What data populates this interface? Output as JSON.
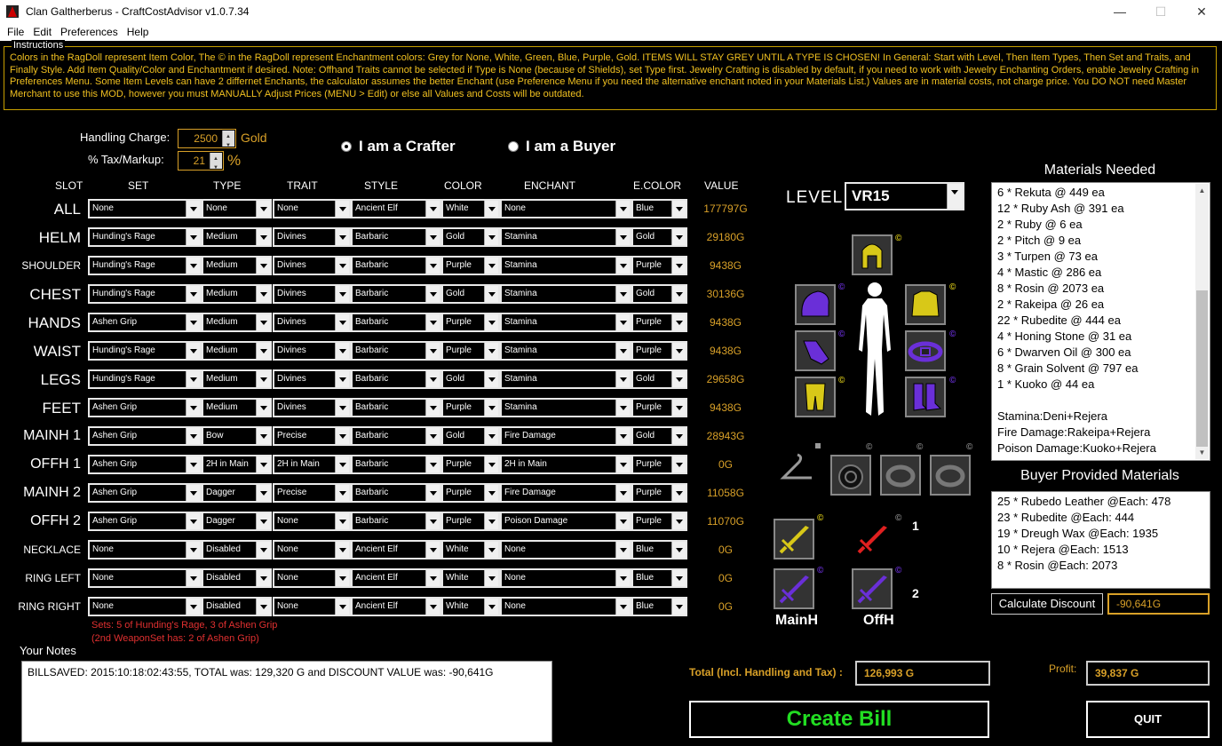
{
  "window": {
    "title": "Clan Galtherberus - CraftCostAdvisor v1.0.7.34",
    "minimize": "—",
    "maximize": "☐",
    "close": "✕"
  },
  "menu": [
    "File",
    "Edit",
    "Preferences",
    "Help"
  ],
  "instructions": {
    "legend": "Instructions",
    "text": "Colors in the RagDoll represent Item Color, The © in the RagDoll represent Enchantment colors:  Grey for None, White, Green, Blue, Purple, Gold.  ITEMS WILL STAY GREY UNTIL A TYPE IS CHOSEN!  In General:  Start with Level, Then Item Types, Then Set and Traits, and Finally Style.  Add Item Quality/Color and Enchantment if desired. Note: Offhand Traits cannot be selected if Type is None (because of Shields), set Type first.  Jewelry Crafting is disabled by default, if you need to work with Jewelry Enchanting Orders, enable Jewelry Crafting in Preferences Menu.  Some Item Levels can have 2 differnet Enchants, the calculator assumes the better Enchant (use Preference Menu if you need the alternative enchant noted in your Materials List.) Values are in material costs, not charge price.  You DO NOT need Master Merchant to use this MOD, however you must MANUALLY Adjust Prices (MENU > Edit) or else all Values and Costs will be outdated."
  },
  "charges": {
    "handling_label": "Handling Charge:",
    "handling_value": "2500",
    "handling_unit": "Gold",
    "tax_label": "% Tax/Markup:",
    "tax_value": "21",
    "tax_unit": "%"
  },
  "mode": {
    "crafter": "I am a Crafter",
    "buyer": "I am a Buyer",
    "selected": "crafter"
  },
  "columns": [
    "SLOT",
    "SET",
    "TYPE",
    "TRAIT",
    "STYLE",
    "COLOR",
    "ENCHANT",
    "E.COLOR",
    "VALUE"
  ],
  "rows": [
    {
      "slot": "ALL",
      "set": "None",
      "type": "None",
      "trait": "None",
      "style": "Ancient Elf",
      "color": "White",
      "enchant": "None",
      "ecolor": "Blue",
      "value": "177797G"
    },
    {
      "slot": "HELM",
      "set": "Hunding's Rage",
      "type": "Medium",
      "trait": "Divines",
      "style": "Barbaric",
      "color": "Gold",
      "enchant": "Stamina",
      "ecolor": "Gold",
      "value": "29180G"
    },
    {
      "slot": "SHOULDER",
      "set": "Hunding's Rage",
      "type": "Medium",
      "trait": "Divines",
      "style": "Barbaric",
      "color": "Purple",
      "enchant": "Stamina",
      "ecolor": "Purple",
      "value": "9438G"
    },
    {
      "slot": "CHEST",
      "set": "Hunding's Rage",
      "type": "Medium",
      "trait": "Divines",
      "style": "Barbaric",
      "color": "Gold",
      "enchant": "Stamina",
      "ecolor": "Gold",
      "value": "30136G"
    },
    {
      "slot": "HANDS",
      "set": "Ashen Grip",
      "type": "Medium",
      "trait": "Divines",
      "style": "Barbaric",
      "color": "Purple",
      "enchant": "Stamina",
      "ecolor": "Purple",
      "value": "9438G"
    },
    {
      "slot": "WAIST",
      "set": "Hunding's Rage",
      "type": "Medium",
      "trait": "Divines",
      "style": "Barbaric",
      "color": "Purple",
      "enchant": "Stamina",
      "ecolor": "Purple",
      "value": "9438G"
    },
    {
      "slot": "LEGS",
      "set": "Hunding's Rage",
      "type": "Medium",
      "trait": "Divines",
      "style": "Barbaric",
      "color": "Gold",
      "enchant": "Stamina",
      "ecolor": "Gold",
      "value": "29658G"
    },
    {
      "slot": "FEET",
      "set": "Ashen Grip",
      "type": "Medium",
      "trait": "Divines",
      "style": "Barbaric",
      "color": "Purple",
      "enchant": "Stamina",
      "ecolor": "Purple",
      "value": "9438G"
    },
    {
      "slot": "MAINH 1",
      "set": "Ashen Grip",
      "type": "Bow",
      "trait": "Precise",
      "style": "Barbaric",
      "color": "Gold",
      "enchant": "Fire Damage",
      "ecolor": "Gold",
      "value": "28943G"
    },
    {
      "slot": "OFFH 1",
      "set": "Ashen Grip",
      "type": "2H in Main",
      "trait": "2H in Main",
      "style": "Barbaric",
      "color": "Purple",
      "enchant": "2H in Main",
      "ecolor": "Purple",
      "value": "0G"
    },
    {
      "slot": "MAINH 2",
      "set": "Ashen Grip",
      "type": "Dagger",
      "trait": "Precise",
      "style": "Barbaric",
      "color": "Purple",
      "enchant": "Fire Damage",
      "ecolor": "Purple",
      "value": "11058G"
    },
    {
      "slot": "OFFH 2",
      "set": "Ashen Grip",
      "type": "Dagger",
      "trait": "None",
      "style": "Barbaric",
      "color": "Purple",
      "enchant": "Poison Damage",
      "ecolor": "Purple",
      "value": "11070G"
    },
    {
      "slot": "NECKLACE",
      "set": "None",
      "type": "Disabled",
      "trait": "None",
      "style": "Ancient Elf",
      "color": "White",
      "enchant": "None",
      "ecolor": "Blue",
      "value": "0G"
    },
    {
      "slot": "RING LEFT",
      "set": "None",
      "type": "Disabled",
      "trait": "None",
      "style": "Ancient Elf",
      "color": "White",
      "enchant": "None",
      "ecolor": "Blue",
      "value": "0G"
    },
    {
      "slot": "RING RIGHT",
      "set": "None",
      "type": "Disabled",
      "trait": "None",
      "style": "Ancient Elf",
      "color": "White",
      "enchant": "None",
      "ecolor": "Blue",
      "value": "0G"
    }
  ],
  "sets_note": {
    "line1": "Sets: 5 of Hunding's Rage, 3 of Ashen Grip",
    "line2": "(2nd WeaponSet has: 2 of Ashen Grip)"
  },
  "level": {
    "label": "LEVEL",
    "value": "VR15"
  },
  "ragdoll": {
    "copyright": "©",
    "weapon_set_1": "1",
    "weapon_set_2": "2",
    "mainh_label": "MainH",
    "offh_label": "OffH"
  },
  "materials": {
    "title": "Materials Needed",
    "items": [
      "6 * Rekuta @ 449 ea",
      "12 * Ruby Ash @ 391 ea",
      "2 * Ruby @ 6 ea",
      "2 * Pitch @ 9 ea",
      "3 * Turpen @ 73 ea",
      "4 * Mastic @ 286 ea",
      "8 * Rosin @ 2073 ea",
      "2 * Rakeipa @ 26 ea",
      "22 * Rubedite @ 444 ea",
      "4 * Honing Stone @ 31 ea",
      "6 * Dwarven Oil @ 300 ea",
      "8 * Grain Solvent @ 797 ea",
      "1 * Kuoko @ 44 ea",
      "",
      "Stamina:Deni+Rejera",
      "Fire Damage:Rakeipa+Rejera",
      "Poison Damage:Kuoko+Rejera"
    ]
  },
  "buyer": {
    "title": "Buyer Provided Materials",
    "items": [
      "25 * Rubedo Leather @Each: 478",
      "23 * Rubedite @Each: 444",
      "19 * Dreugh Wax @Each: 1935",
      "10 * Rejera @Each: 1513",
      "8 * Rosin @Each: 2073"
    ]
  },
  "discount": {
    "button": "Calculate Discount",
    "value": "-90,641G"
  },
  "notes": {
    "label": "Your Notes",
    "text": "BILLSAVED: 2015:10:18:02:43:55, TOTAL was: 129,320 G and DISCOUNT VALUE was: -90,641G"
  },
  "totals": {
    "total_label": "Total (Incl. Handling and Tax) :",
    "total_value": "126,993 G",
    "profit_label": "Profit:",
    "profit_value": "39,837 G"
  },
  "buttons": {
    "create_bill": "Create Bill",
    "quit": "QUIT"
  },
  "colors": {
    "gold": "#d8a028",
    "purple": "#6a2fd8",
    "green_btn": "#22dd22",
    "item_gold": "#d8c818"
  }
}
